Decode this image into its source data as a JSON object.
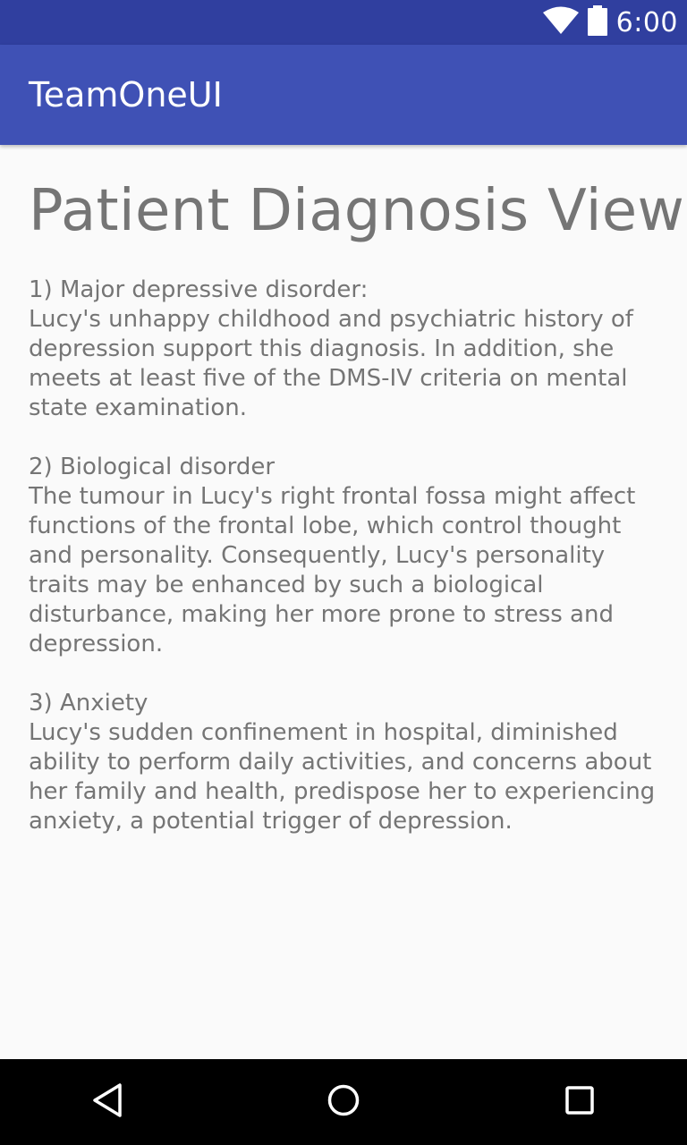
{
  "status_bar": {
    "time": "6:00",
    "icons": [
      "wifi-icon",
      "battery-icon"
    ]
  },
  "app_bar": {
    "title": "TeamOneUI",
    "color": "#3f51b5",
    "status_color": "#303f9f"
  },
  "main": {
    "title": "Patient Diagnosis View",
    "diagnoses": [
      {
        "heading": "1) Major depressive disorder:",
        "text": "Lucy's unhappy childhood and psychiatric history of depression support this diagnosis. In addition, she meets at least five of the DMS-IV criteria on mental state examination."
      },
      {
        "heading": "2) Biological disorder",
        "text": "The tumour in Lucy's right frontal fossa might affect functions of the frontal lobe, which control thought and personality. Consequently, Lucy's personality traits may be enhanced by such a biological disturbance, making her more prone to stress and depression."
      },
      {
        "heading": "3) Anxiety",
        "text": "Lucy's sudden confinement in hospital, diminished ability to perform daily activities, and concerns about her family and health, predispose her to experiencing anxiety, a potential trigger of depression."
      }
    ]
  },
  "nav_bar": {
    "buttons": [
      "back-icon",
      "home-icon",
      "recents-icon"
    ]
  }
}
